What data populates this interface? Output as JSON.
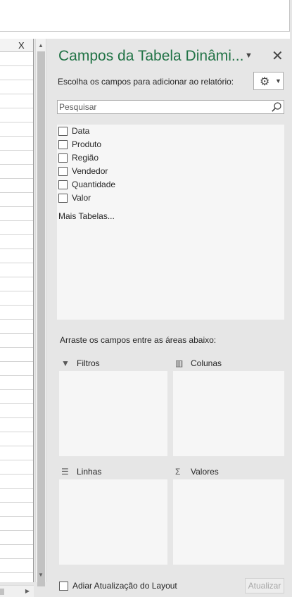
{
  "spreadsheet": {
    "column_letter": "X"
  },
  "pane": {
    "title": "Campos da Tabela Dinâmi...",
    "choose_fields_text": "Escolha os campos para adicionar ao relatório:",
    "search_placeholder": "Pesquisar",
    "fields": [
      {
        "label": "Data",
        "checked": false
      },
      {
        "label": "Produto",
        "checked": false
      },
      {
        "label": "Região",
        "checked": false
      },
      {
        "label": "Vendedor",
        "checked": false
      },
      {
        "label": "Quantidade",
        "checked": false
      },
      {
        "label": "Valor",
        "checked": false
      }
    ],
    "more_tables": "Mais Tabelas...",
    "drag_text": "Arraste os campos entre as áreas abaixo:",
    "areas": {
      "filters": "Filtros",
      "columns": "Colunas",
      "rows": "Linhas",
      "values": "Valores"
    },
    "defer_update": {
      "label": "Adiar Atualização do Layout",
      "checked": false
    },
    "update_button": "Atualizar"
  },
  "icons": {
    "title_dropdown": "dropdown-arrow-icon",
    "close": "close-icon",
    "settings": "gear-icon",
    "search": "search-icon",
    "filters": "filter-icon",
    "columns": "columns-icon",
    "rows": "rows-icon",
    "values": "sigma-icon"
  },
  "colors": {
    "title": "#217346",
    "pane_background": "#e6e6e6",
    "list_background": "#f6f6f6"
  }
}
